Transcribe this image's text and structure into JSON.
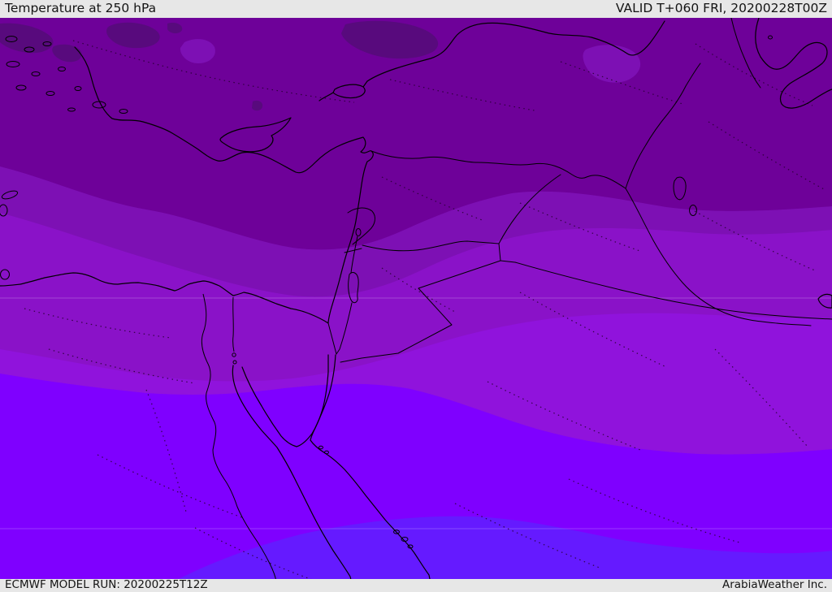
{
  "header": {
    "title": "Temperature at 250 hPa",
    "valid_label": "VALID T+060 FRI, 20200228T00Z"
  },
  "footer": {
    "model_run": "ECMWF MODEL RUN: 20200225T12Z",
    "credit": "ArabiaWeather Inc."
  },
  "map": {
    "kind": "temperature shaded contour map",
    "level": "250 hPa",
    "colors": {
      "band_coldest": "#580a7d",
      "band_cold": "#6e0199",
      "band_cool": "#7d10b4",
      "band_mid": "#8a12c8",
      "band_warm": "#9013dc",
      "band_warmer": "#7f00ff",
      "band_warmest": "#651aff",
      "coastline": "#000000",
      "bar_background": "#e7e7e7",
      "bar_text": "#141414"
    },
    "bands_order_north_to_south": [
      "band_coldest",
      "band_cold",
      "band_cool",
      "band_mid",
      "band_warm",
      "band_warmer",
      "band_warmest"
    ]
  }
}
